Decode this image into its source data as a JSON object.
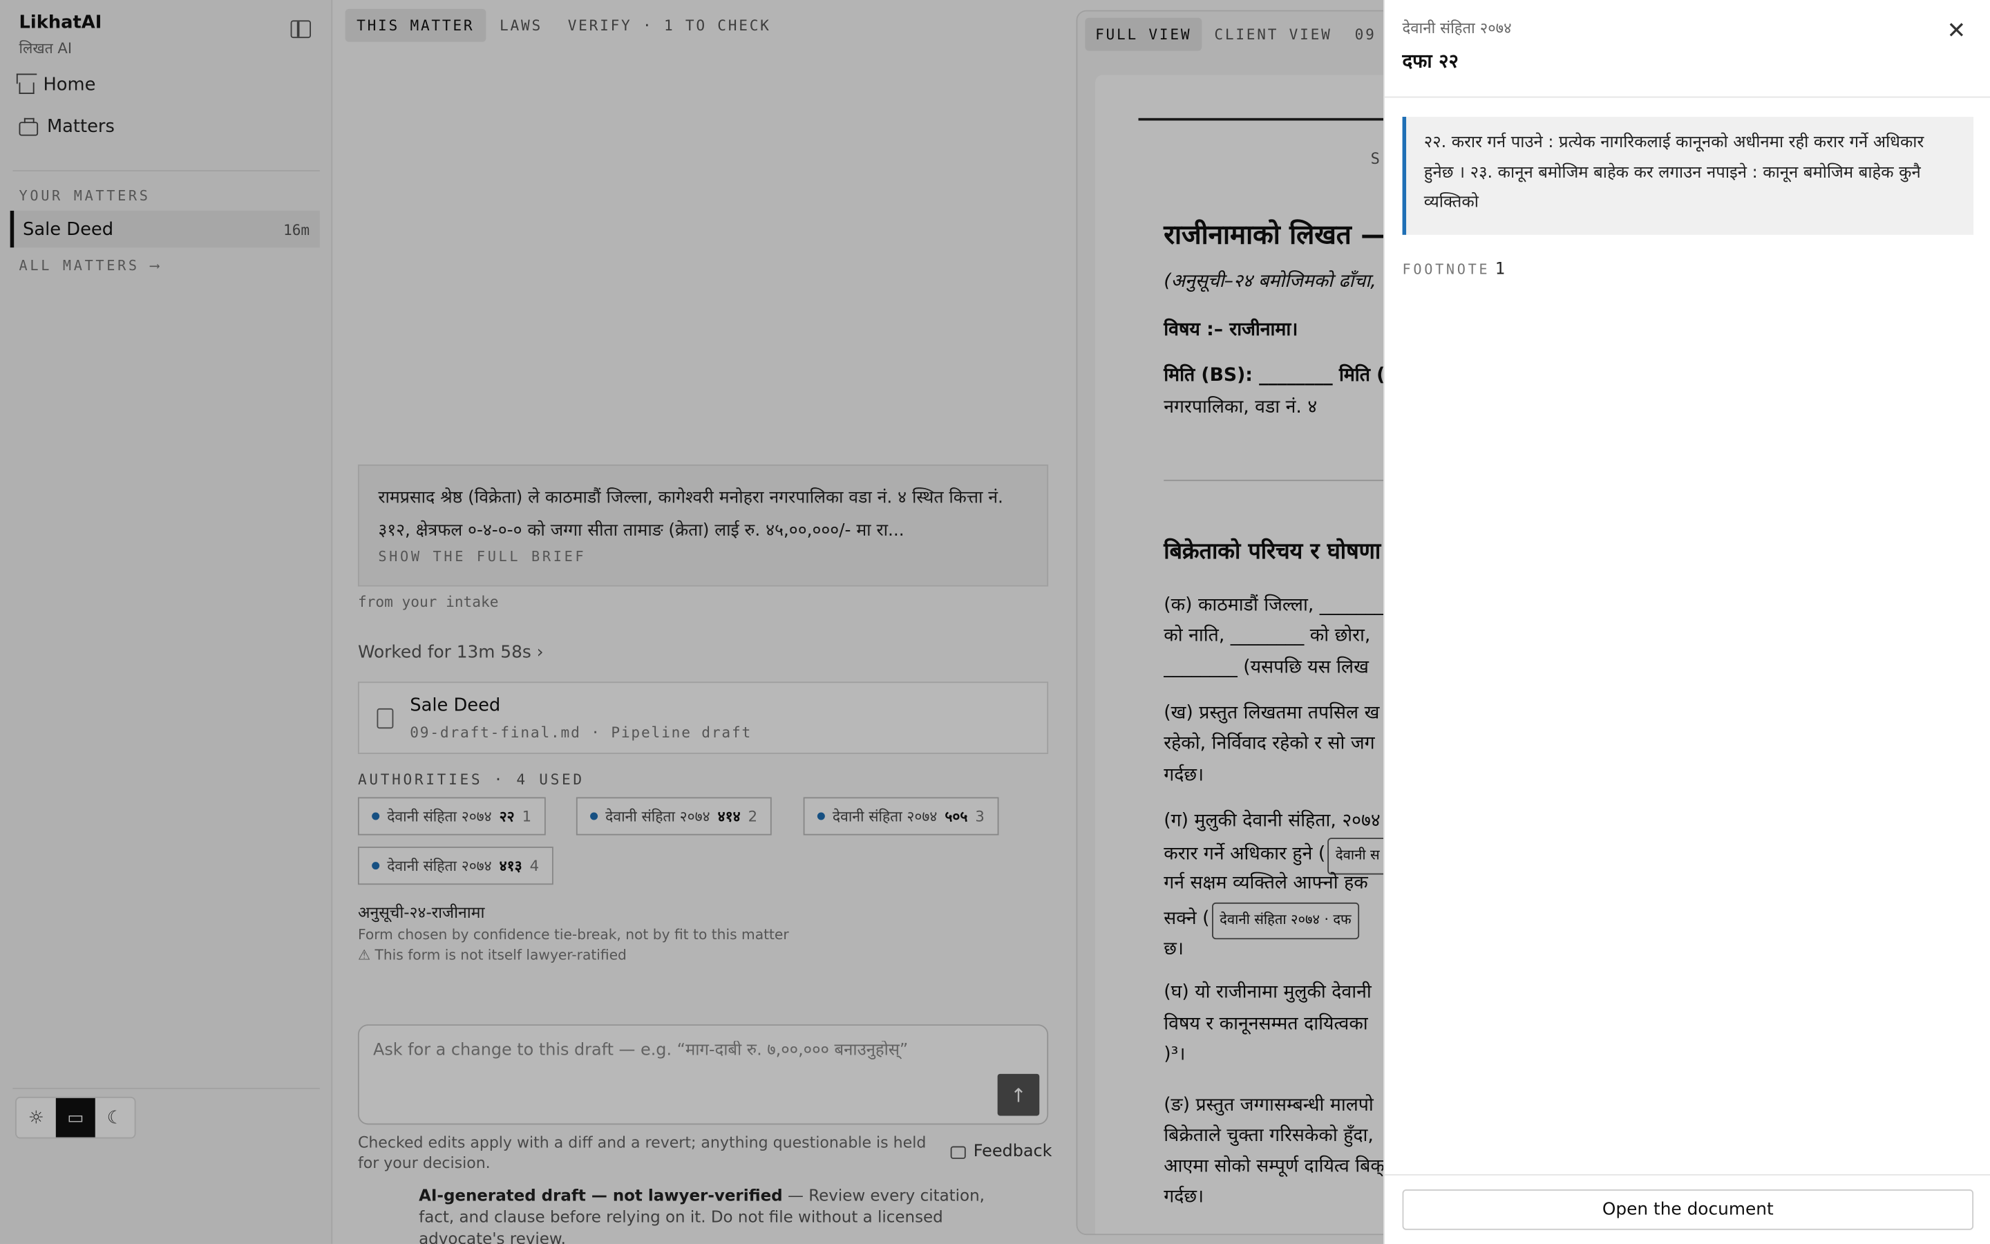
{
  "sidebar": {
    "brand": "LikhatAI",
    "brand_sub": "लिखत AI",
    "nav": [
      {
        "label": "Home",
        "icon": "home-icon"
      },
      {
        "label": "Matters",
        "icon": "briefcase-icon"
      }
    ],
    "section_label": "YOUR MATTERS",
    "matters": [
      {
        "label": "Sale Deed",
        "age": "16m"
      }
    ],
    "all_matters": "ALL MATTERS ⟶",
    "theme_options": [
      "light",
      "system",
      "dark"
    ]
  },
  "center": {
    "tabs": [
      "THIS MATTER",
      "LAWS",
      "VERIFY · 1 TO CHECK"
    ],
    "brief_text": "रामप्रसाद श्रेष्ठ (विक्रेता) ले काठमाडौं जिल्ला, कागेश्वरी मनोहरा नगरपालिका वडा नं. ४ स्थित कित्ता नं. ३१२, क्षेत्रफल ०-४-०-० को जग्गा सीता तामाङ (क्रेता) लाई रु. ४५,००,०००/- मा रा...",
    "brief_more": "SHOW THE FULL BRIEF",
    "from_intake": "from your intake",
    "worked": "Worked for 13m 58s ›",
    "doc_card": {
      "title": "Sale Deed",
      "meta": "09-draft-final.md · Pipeline draft"
    },
    "authorities_label": "AUTHORITIES · 4 USED",
    "authorities": [
      {
        "code": "देवानी संहिता २०७४",
        "section": "२२",
        "n": "1"
      },
      {
        "code": "देवानी संहिता २०७४",
        "section": "४१४",
        "n": "2"
      },
      {
        "code": "देवानी संहिता २०७४",
        "section": "५०५",
        "n": "3"
      },
      {
        "code": "देवानी संहिता २०७४",
        "section": "४१३",
        "n": "4"
      }
    ],
    "form_title": "अनुसूची-२४-राजीनामा",
    "form_note": "Form chosen by confidence tie-break, not by fit to this matter",
    "form_warn": "⚠ This form is not itself lawyer-ratified",
    "composer_placeholder": "Ask for a change to this draft — e.g. “माग-दाबी रु. ७,००,००० बनाउनुहोस्”",
    "edits_note": "Checked edits apply with a diff and a revert; anything questionable is held for your decision.",
    "feedback": "Feedback",
    "disclaimer_bold": "AI-generated draft — not lawyer-verified",
    "disclaimer_rest": " — Review every citation, fact, and clause before relying on it. Do not file without a licensed advocate's review."
  },
  "doc": {
    "tabs": [
      "FULL VIEW",
      "CLIENT VIEW",
      "09"
    ],
    "s_letter": "S",
    "heading": "राजीनामाको लिखत —",
    "subheading": "(अनुसूची–२४ बमोजिमको ढाँचा,",
    "subject": "विषय :– राजीनामा।",
    "date_line": "मिति (BS): ________ मिति (",
    "ward_line": "नगरपालिका, वडा नं. ४",
    "section_heading": "बिक्रेताको परिचय र घोषणा",
    "para_a": [
      "(क) काठमाडौं जिल्ला, ________",
      "को नाति, ________ को छोरा,",
      "________ (यसपछि यस लिख"
    ],
    "para_b": [
      "(ख) प्रस्तुत लिखतमा तपसिल ख",
      "रहेको, निर्विवाद रहेको र सो जग",
      "गर्दछ।"
    ],
    "para_c_1": "(ग) मुलुकी देवानी संहिता, २०७४",
    "para_c_2a": "करार गर्ने अधिकार हुने (",
    "para_c_2cite": "देवानी स",
    "para_c_3": "गर्न सक्षम व्यक्तिले आफ्नो हक",
    "para_c_4a": "सक्ने (",
    "para_c_4cite": "देवानी संहिता २०७४ · दफ",
    "para_c_5": "छ।",
    "para_d": [
      "(घ) यो राजीनामा मुलुकी देवानी",
      "विषय र कानूनसम्मत दायित्वका",
      ")³।"
    ],
    "para_e": [
      "(ङ) प्रस्तुत जग्गासम्बन्धी मालपो",
      "बिक्रेताले चुक्ता गरिसकेको हुँदा,",
      "आएमा सोको सम्पूर्ण दायित्व बिक्",
      "गर्दछ।"
    ]
  },
  "panel": {
    "kicker": "देवानी संहिता २०७४",
    "title": "दफा २२",
    "quote": "२२. करार गर्न पाउने : प्रत्येक नागरिकलाई कानूनको अधीनमा रही करार गर्ने अधिकार हुनेछ । २३. कानून बमोजिम बाहेक कर लगाउन नपाइने : कानून बमोजिम बाहेक कुनै व्यक्तिको",
    "footnote_label": "FOOTNOTE",
    "footnote_num": "1",
    "open_button": "Open the document"
  },
  "colors": {
    "accent": "#1f6fb5",
    "overlay": "rgba(0,0,0,0.28)"
  }
}
